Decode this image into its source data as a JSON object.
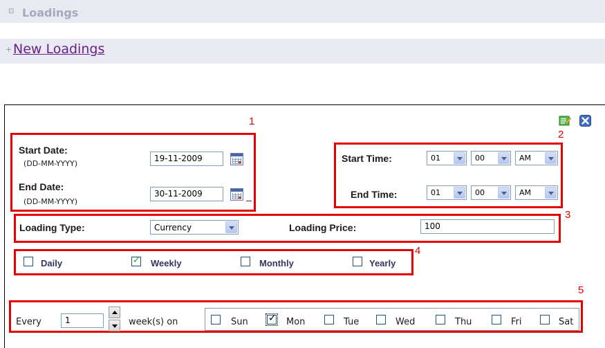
{
  "header": {
    "title": "Loadings",
    "new_link": "New Loadings"
  },
  "markers": [
    "1",
    "2",
    "3",
    "4",
    "5"
  ],
  "dates": {
    "start_label": "Start Date:",
    "start_format": "(DD-MM-YYYY)",
    "start_value": "19-11-2009",
    "end_label": "End Date:",
    "end_format": "(DD-MM-YYYY)",
    "end_value": "30-11-2009"
  },
  "times": {
    "start_label": "Start Time:",
    "end_label": "End Time:",
    "start_hour": "01",
    "start_minute": "00",
    "start_ampm": "AM",
    "end_hour": "01",
    "end_minute": "00",
    "end_ampm": "AM"
  },
  "loading": {
    "type_label": "Loading Type:",
    "type_value": "Currency",
    "price_label": "Loading Price:",
    "price_value": "100"
  },
  "recurrence": {
    "daily": "Daily",
    "weekly": "Weekly",
    "monthly": "Monthly",
    "yearly": "Yearly",
    "selected": "Weekly"
  },
  "weekly": {
    "every_label": "Every",
    "every_value": "1",
    "weeks_label": "week(s) on",
    "days": [
      "Sun",
      "Mon",
      "Tue",
      "Wed",
      "Thu",
      "Fri",
      "Sat"
    ],
    "checked_day": "Mon"
  },
  "colors": {
    "red_outline": "#e40000",
    "link_purple": "#6b1f8a",
    "check_green": "#21a121"
  }
}
